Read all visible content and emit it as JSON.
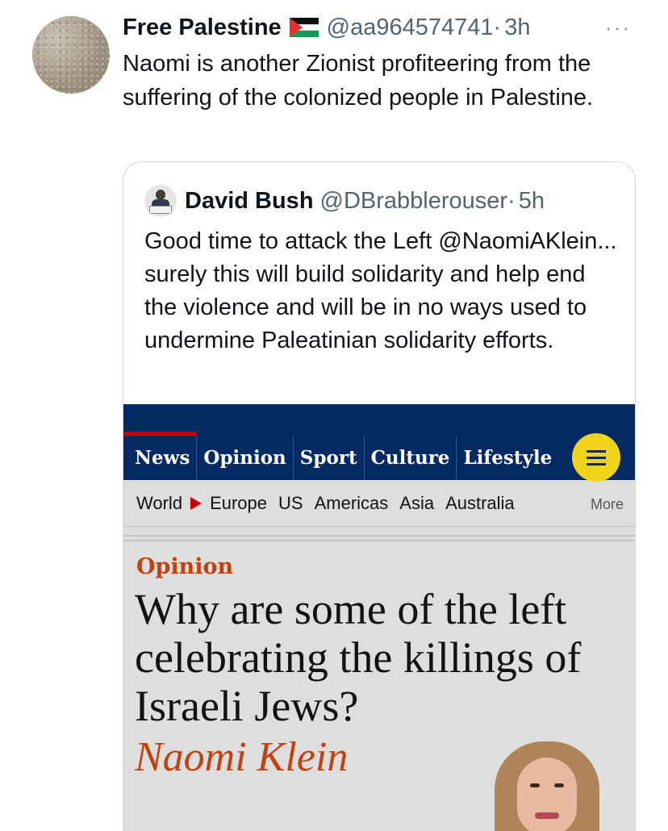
{
  "tweet": {
    "author_name": "Free Palestine",
    "flag_icon": "palestine-flag-icon",
    "handle": "@aa964574741",
    "separator": "·",
    "time": "3h",
    "more_label": "···",
    "text": "Naomi is another Zionist profiteering from the suffering of the colonized people in Palestine."
  },
  "quote": {
    "author_name": "David Bush",
    "handle": "@DBrabblerouser",
    "separator": "·",
    "time": "5h",
    "text": "Good time to attack the Left @NaomiAKlein... surely this will build solidarity and help end the violence and will be in no ways used to undermine Paleatinian solidarity efforts."
  },
  "article": {
    "nav": [
      "News",
      "Opinion",
      "Sport",
      "Culture",
      "Lifestyle"
    ],
    "subnav": [
      "World",
      "Europe",
      "US",
      "Americas",
      "Asia",
      "Australia"
    ],
    "subnav_more": "More",
    "kicker": "Opinion",
    "headline": "Why are some of the left celebrating the killings of Israeli Jews?",
    "byline": "Naomi Klein",
    "colors": {
      "navy": "#052962",
      "accent": "#c4400e",
      "menu": "#f2d31b",
      "background": "#dedede"
    }
  }
}
